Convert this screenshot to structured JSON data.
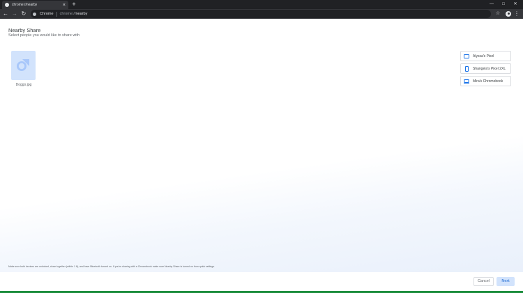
{
  "browser": {
    "tab": {
      "title": "chrome://nearby",
      "favicon": "chrome-icon"
    },
    "new_tab_symbol": "+",
    "window_controls": {
      "minimize": "—",
      "maximize": "□",
      "close": "✕"
    },
    "toolbar": {
      "back": "←",
      "forward": "→",
      "reload": "↻",
      "site_name": "Chrome",
      "url_scheme": "chrome://",
      "url_host": "nearby",
      "bookmark": "☆",
      "menu": "⋮"
    }
  },
  "page": {
    "title": "Nearby Share",
    "subtitle": "Select people you would like to share with",
    "file": {
      "name": "Doggo.jpg",
      "icon": "image-file-icon"
    },
    "devices": [
      {
        "label": "Alyssa's Pixel",
        "icon": "tablet-icon"
      },
      {
        "label": "Shangela's Pixel 2XL",
        "icon": "phone-icon"
      },
      {
        "label": "Mira's Chromebook",
        "icon": "laptop-icon"
      }
    ],
    "footer_note": "Make sure both devices are unlocked, close together (within 1 ft), and have Bluetooth turned on. If you're sharing with a Chromebook make sure Nearby Share is turned on from quick settings."
  },
  "actions": {
    "cancel": "Cancel",
    "next": "Next"
  },
  "colors": {
    "accent": "#1a73e8",
    "accent_light": "#d2e3fc",
    "toolbar": "#35363a",
    "tabstrip": "#202124"
  }
}
